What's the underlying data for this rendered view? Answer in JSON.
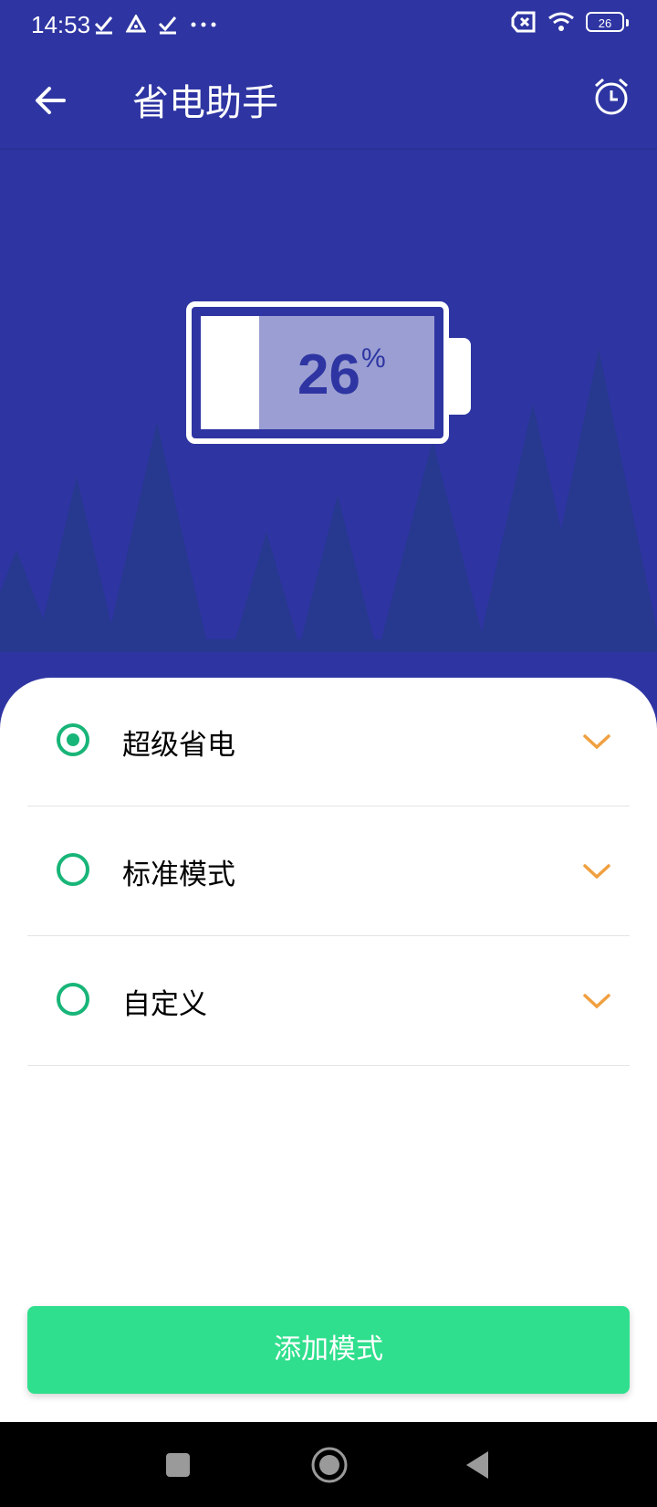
{
  "status_bar": {
    "time": "14:53",
    "battery_level": "26",
    "icons": [
      "check-icon",
      "drive-icon",
      "check-icon",
      "more-icon",
      "sim-off-icon",
      "wifi-icon",
      "battery-icon"
    ]
  },
  "header": {
    "title": "省电助手",
    "back_icon": "arrow-left-icon",
    "alarm_icon": "alarm-clock-icon"
  },
  "battery": {
    "value": "26",
    "unit": "%"
  },
  "modes": [
    {
      "label": "超级省电",
      "selected": true
    },
    {
      "label": "标准模式",
      "selected": false
    },
    {
      "label": "自定义",
      "selected": false
    }
  ],
  "actions": {
    "add_mode": "添加模式"
  },
  "colors": {
    "primary": "#2e35a2",
    "accent_green": "#18b578",
    "button_green": "#30df8d",
    "chevron_orange": "#f0a040"
  }
}
